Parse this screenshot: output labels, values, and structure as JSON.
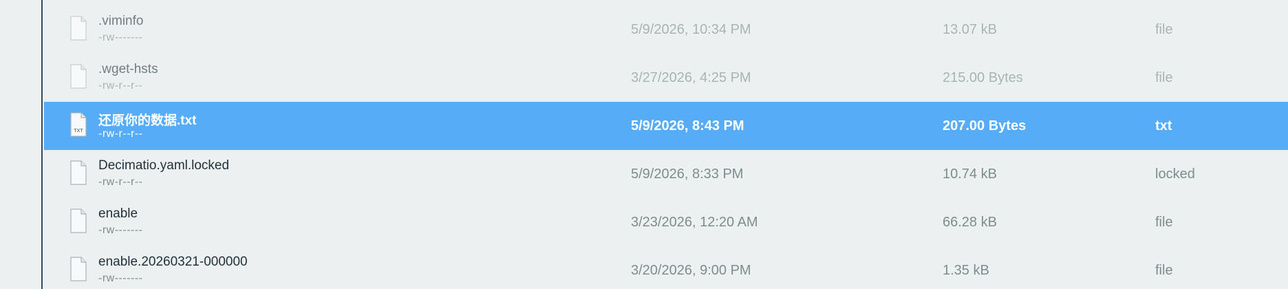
{
  "files": [
    {
      "name": ".viminfo",
      "perms": "-rw-------",
      "date": "5/9/2026, 10:34 PM",
      "size": "13.07 kB",
      "type": "file",
      "icon": "file-icon"
    },
    {
      "name": ".wget-hsts",
      "perms": "-rw-r--r--",
      "date": "3/27/2026, 4:25 PM",
      "size": "215.00 Bytes",
      "type": "file",
      "icon": "file-icon"
    },
    {
      "name": "还原你的数据.txt",
      "perms": "-rw-r--r--",
      "date": "5/9/2026, 8:43 PM",
      "size": "207.00 Bytes",
      "type": "txt",
      "icon": "txt-file-icon",
      "icon_label": "TXT"
    },
    {
      "name": "Decimatio.yaml.locked",
      "perms": "-rw-r--r--",
      "date": "5/9/2026, 8:33 PM",
      "size": "10.74 kB",
      "type": "locked",
      "icon": "file-icon"
    },
    {
      "name": "enable",
      "perms": "-rw-------",
      "date": "3/23/2026, 12:20 AM",
      "size": "66.28 kB",
      "type": "file",
      "icon": "file-icon"
    },
    {
      "name": "enable.20260321-000000",
      "perms": "-rw-------",
      "date": "3/20/2026, 9:00 PM",
      "size": "1.35 kB",
      "type": "file",
      "icon": "file-icon"
    }
  ],
  "selected_index": 2,
  "colors": {
    "background": "#ecf0f1",
    "selected_row": "#56acf6",
    "divider": "#34495e",
    "text_primary": "#22313a",
    "text_secondary": "#7f8c8d"
  }
}
